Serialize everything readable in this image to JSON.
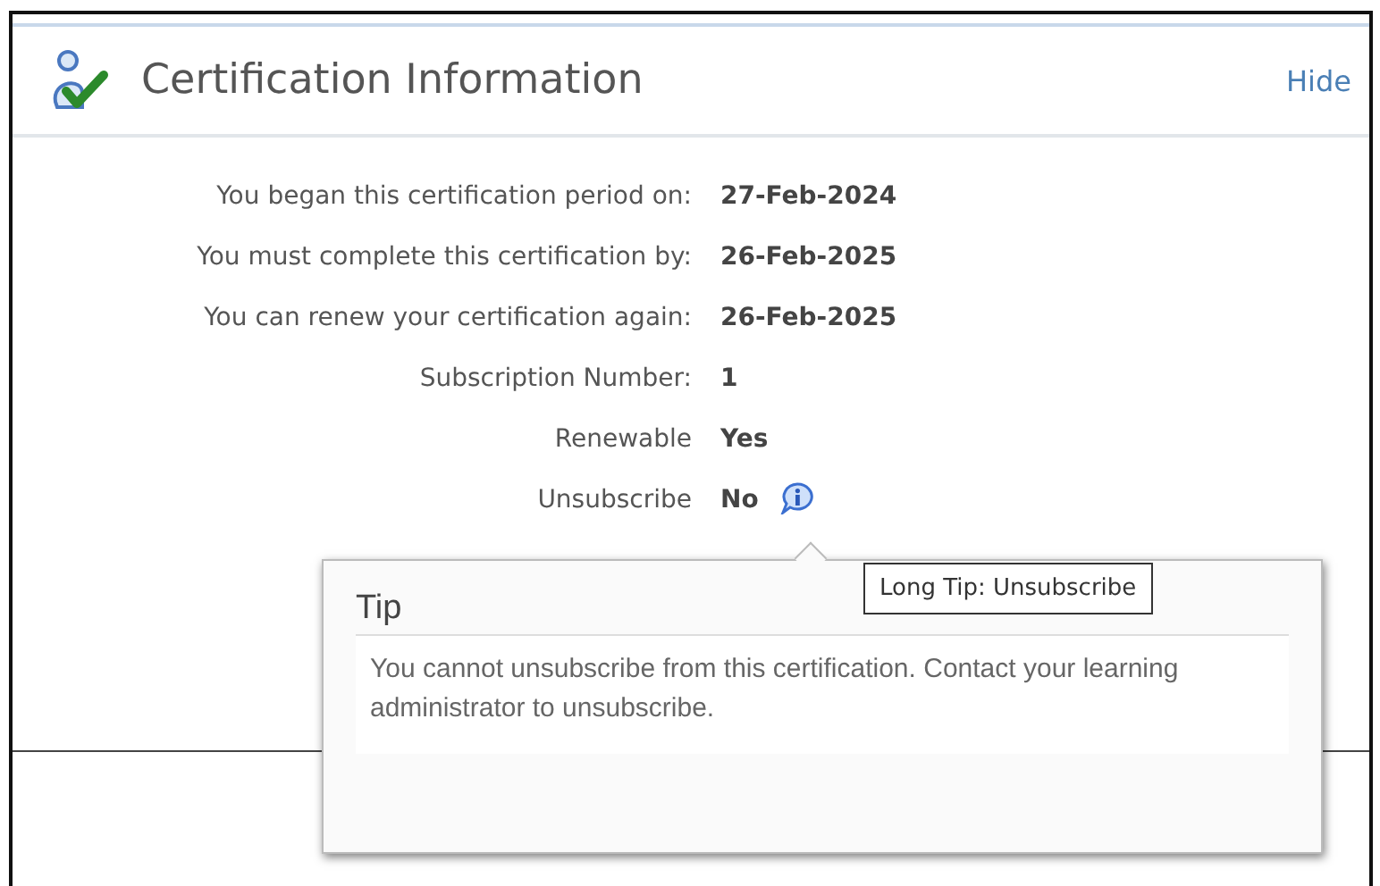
{
  "panel": {
    "title": "Certification Information",
    "hide_link": "Hide"
  },
  "fields": [
    {
      "label": "You began this certification period on:",
      "value": "27-Feb-2024"
    },
    {
      "label": "You must complete this certification by:",
      "value": "26-Feb-2025"
    },
    {
      "label": "You can renew your certification again:",
      "value": "26-Feb-2025"
    },
    {
      "label": "Subscription Number:",
      "value": "1"
    },
    {
      "label": "Renewable",
      "value": "Yes"
    },
    {
      "label": "Unsubscribe",
      "value": "No",
      "info": true
    }
  ],
  "tip": {
    "title": "Tip",
    "text": "You cannot unsubscribe from this certification. Contact your learning administrator to unsubscribe."
  },
  "hover_tooltip": "Long Tip: Unsubscribe"
}
